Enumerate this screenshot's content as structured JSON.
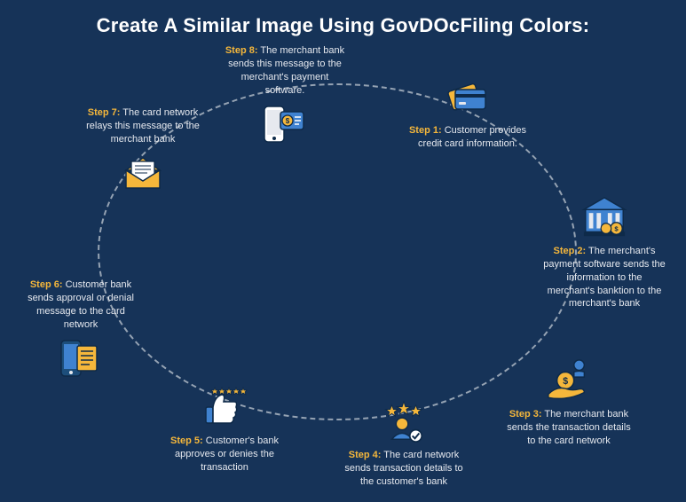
{
  "title": "Create A Similar Image Using GovDOcFiling Colors:",
  "steps": {
    "s1": {
      "label": "Step 1:",
      "text": "Customer provides credit card information."
    },
    "s2": {
      "label": "Step 2:",
      "text": "The merchant's payment software sends the information to the merchant's banktion to the merchant's bank"
    },
    "s3": {
      "label": "Step 3:",
      "text": "The merchant bank sends the transaction details to the card network"
    },
    "s4": {
      "label": "Step 4:",
      "text": "The card network sends transaction details to the customer's bank"
    },
    "s5": {
      "label": "Step 5:",
      "text": "Customer's bank approves or denies the transaction"
    },
    "s6": {
      "label": "Step 6:",
      "text": "Customer bank sends approval or denial message to the card network"
    },
    "s7": {
      "label": "Step 7:",
      "text": "The card network relays this message to the merchant bank"
    },
    "s8": {
      "label": "Step 8:",
      "text": "The merchant bank sends this message to the merchant's payment software."
    }
  },
  "colors": {
    "background": "#163358",
    "heading": "#ffffff",
    "step_label": "#f5b73b",
    "body_text": "#e6e9ef",
    "accent_blue": "#3f82d0",
    "accent_gold": "#f5b73b"
  }
}
